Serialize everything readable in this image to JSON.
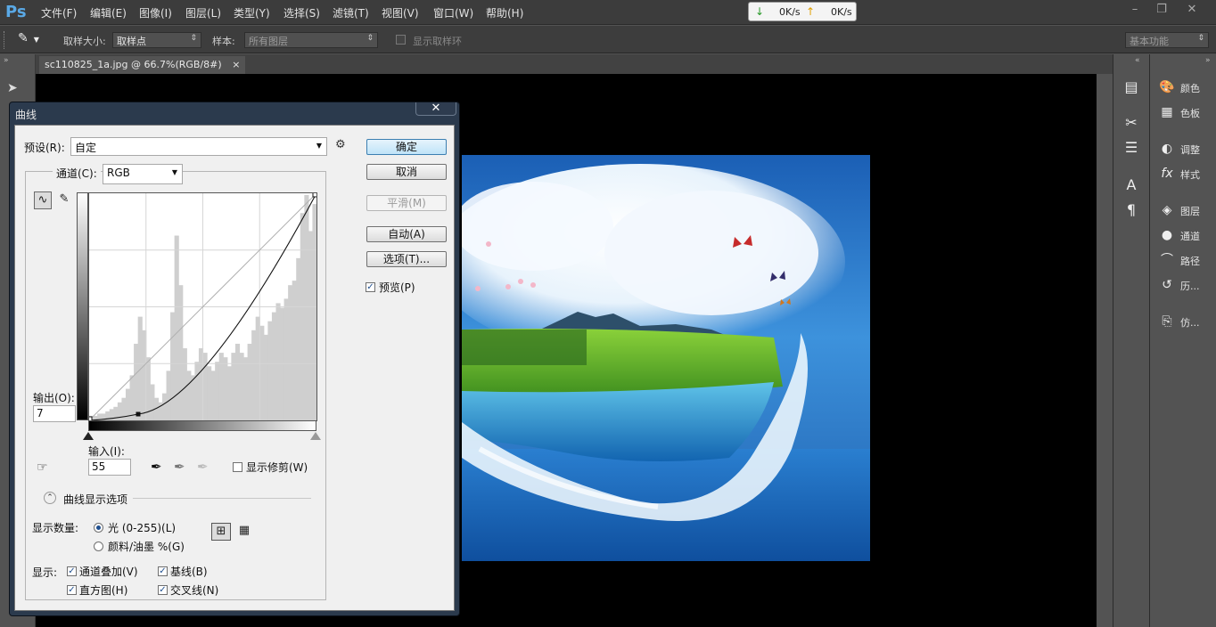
{
  "app": {
    "logo": "Ps"
  },
  "menus": [
    "文件(F)",
    "编辑(E)",
    "图像(I)",
    "图层(L)",
    "类型(Y)",
    "选择(S)",
    "滤镜(T)",
    "视图(V)",
    "窗口(W)",
    "帮助(H)"
  ],
  "network": {
    "down_speed": "0K/s",
    "up_speed": "0K/s"
  },
  "window_controls": {
    "minimize": "–",
    "restore": "❐",
    "close": "✕"
  },
  "options_bar": {
    "sample_size_label": "取样大小:",
    "sample_size_value": "取样点",
    "sample_label": "样本:",
    "sample_value": "所有图层",
    "show_ring_label": "显示取样环",
    "workspace": "基本功能"
  },
  "document": {
    "tab_title": "sc110825_1a.jpg @ 66.7%(RGB/8#)",
    "tab_close": "×"
  },
  "right_panels": [
    {
      "icon": "palette-icon",
      "glyph": "🎨",
      "label": "颜色"
    },
    {
      "icon": "swatches-icon",
      "glyph": "▦",
      "label": "色板"
    },
    {
      "icon": "adjustments-icon",
      "glyph": "◐",
      "label": "调整"
    },
    {
      "icon": "fx-icon",
      "glyph": "fx",
      "label": "样式"
    },
    {
      "icon": "layers-icon",
      "glyph": "◈",
      "label": "图层"
    },
    {
      "icon": "channels-icon",
      "glyph": "●",
      "label": "通道"
    },
    {
      "icon": "paths-icon",
      "glyph": "⌒",
      "label": "路径"
    },
    {
      "icon": "history-icon",
      "glyph": "↺",
      "label": "历..."
    },
    {
      "icon": "clone-source-icon",
      "glyph": "⎘",
      "label": "仿..."
    }
  ],
  "curves_dialog": {
    "title": "曲线",
    "close": "✕",
    "preset_label": "预设(R):",
    "preset_value": "自定",
    "channel_label": "通道(C):",
    "channel_value": "RGB",
    "output_label": "输出(O):",
    "output_value": "7",
    "input_label": "输入(I):",
    "input_value": "55",
    "show_clipping_label": "显示修剪(W)",
    "buttons": {
      "ok": "确定",
      "cancel": "取消",
      "smooth": "平滑(M)",
      "auto": "自动(A)",
      "options": "选项(T)..."
    },
    "preview_label": "预览(P)",
    "preview_checked": true,
    "display_options_label": "曲线显示选项",
    "show_amount_label": "显示数量:",
    "light_label": "光 (0-255)(L)",
    "pigment_label": "颜料/油墨 %(G)",
    "show_label": "显示:",
    "channel_overlays_label": "通道叠加(V)",
    "baseline_label": "基线(B)",
    "histogram_label": "直方图(H)",
    "intersection_label": "交叉线(N)",
    "curve_point": {
      "input": 55,
      "output": 7
    },
    "histogram": [
      2,
      2,
      3,
      3,
      4,
      5,
      6,
      8,
      10,
      14,
      20,
      34,
      46,
      40,
      28,
      16,
      10,
      8,
      12,
      22,
      48,
      82,
      60,
      32,
      22,
      20,
      26,
      32,
      30,
      24,
      22,
      26,
      30,
      28,
      24,
      30,
      34,
      30,
      28,
      34,
      40,
      46,
      42,
      38,
      44,
      48,
      52,
      50,
      54,
      60,
      62,
      72,
      92,
      100,
      84,
      96
    ]
  }
}
